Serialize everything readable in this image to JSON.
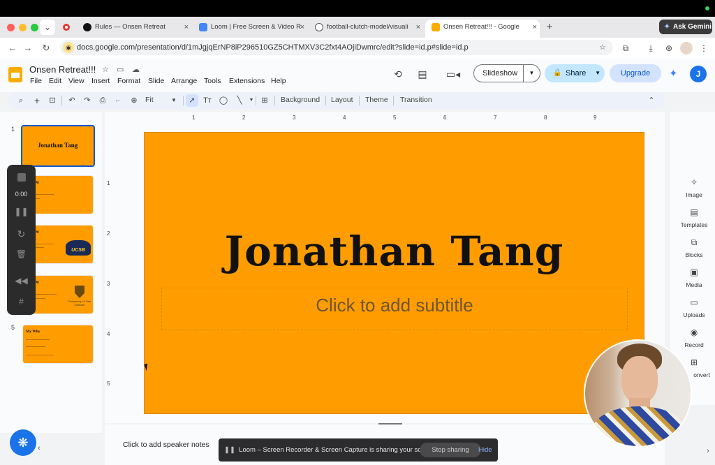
{
  "browser": {
    "tabs": [
      {
        "label": "Rules — Onsen Retreat",
        "active": false
      },
      {
        "label": "Loom | Free Screen & Video R",
        "active": false
      },
      {
        "label": "football-clutch-model/visuali",
        "active": false
      },
      {
        "label": "Onsen Retreat!!! - Google",
        "active": true
      }
    ],
    "url": "docs.google.com/presentation/d/1mJgjqErNP8iP296510GZ5CHTMXV3C2fxt4AOjiDwmrc/edit?slide=id.p#slide=id.p",
    "ask_gemini_label": "Ask Gemini",
    "profile_initial": "J"
  },
  "app": {
    "doc_title": "Onsen Retreat!!!",
    "menus": [
      "File",
      "Edit",
      "View",
      "Insert",
      "Format",
      "Slide",
      "Arrange",
      "Tools",
      "Extensions",
      "Help"
    ],
    "slideshow_label": "Slideshow",
    "share_label": "Share",
    "upgrade_label": "Upgrade",
    "avatar_initial": "J"
  },
  "toolbar": {
    "zoom": "Fit",
    "background_label": "Background",
    "layout_label": "Layout",
    "theme_label": "Theme",
    "transition_label": "Transition"
  },
  "ruler": {
    "horizontal": [
      "1",
      "2",
      "3",
      "4",
      "5",
      "6",
      "7",
      "8",
      "9"
    ],
    "vertical": [
      "1",
      "2",
      "3",
      "4",
      "5"
    ]
  },
  "slide": {
    "title": "Jonathan Tang",
    "subtitle_placeholder": "Click to add subtitle",
    "background_color": "#ff9d00"
  },
  "filmstrip": [
    {
      "number": "1",
      "title": "Jonathan Tang"
    },
    {
      "number": "2",
      "title": "an Tang"
    },
    {
      "number": "3",
      "title": "an Tang",
      "badge": "UCSB"
    },
    {
      "number": "4",
      "title": "an Tang",
      "badge": "University of San Leandro"
    },
    {
      "number": "5",
      "title": "My Why"
    }
  ],
  "recorder": {
    "time": "0:00"
  },
  "side_panel": [
    {
      "label": "Image",
      "icon": "image-sparkle-icon"
    },
    {
      "label": "Templates",
      "icon": "templates-icon"
    },
    {
      "label": "Blocks",
      "icon": "blocks-icon"
    },
    {
      "label": "Media",
      "icon": "media-icon"
    },
    {
      "label": "Uploads",
      "icon": "folder-icon"
    },
    {
      "label": "Record",
      "icon": "record-icon"
    },
    {
      "label": "onvert",
      "icon": "convert-icon"
    }
  ],
  "notes_placeholder": "Click to add speaker notes",
  "loom": {
    "message": "Loom – Screen Recorder & Screen Capture is sharing your screen.",
    "stop_label": "Stop sharing",
    "hide_label": "Hide"
  }
}
